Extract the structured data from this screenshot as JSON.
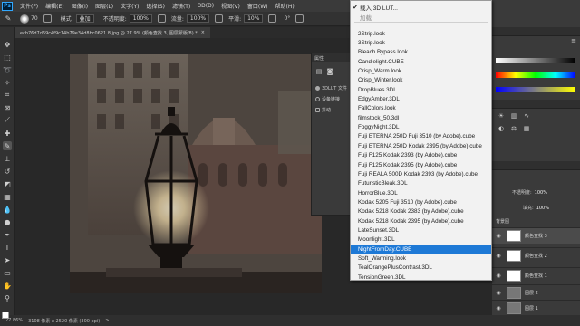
{
  "menubar": {
    "logo": "Ps",
    "items": [
      "文件(F)",
      "编辑(E)",
      "图像(I)",
      "图层(L)",
      "文字(Y)",
      "选择(S)",
      "滤镜(T)",
      "3D(D)",
      "视图(V)",
      "窗口(W)",
      "帮助(H)"
    ],
    "window_controls": [
      "—",
      "□",
      "✕"
    ]
  },
  "options_bar": {
    "brush_size": "70",
    "mode_label": "模式:",
    "mode_value": "叠加",
    "opacity_label": "不透明度:",
    "opacity_value": "100%",
    "flow_label": "流量:",
    "flow_value": "100%",
    "smoothing_label": "平滑:",
    "smoothing_value": "10%",
    "angle_value": "0°"
  },
  "document": {
    "tab_title": "ecb76d7d69c4f9c14b79e34d8bc0621 8.jpg @ 27.9% (颜色查找 3, 图层蒙版/8) *",
    "close_glyph": "×"
  },
  "status_bar": {
    "zoom": "27.86%",
    "doc_size": "3108 像素 x 2520 像素 (300 ppi)",
    "arrow": ">"
  },
  "properties_panel": {
    "title": "属性",
    "option_1": "3DLUT 文件",
    "option_2": "设备链接",
    "option_3": "抖动"
  },
  "lut_menu": {
    "load_label": "载入 3D LUT...",
    "load_checked": "✔",
    "section_label": "加载",
    "items": [
      "2Strip.look",
      "3Strip.look",
      "Bleach Bypass.look",
      "Candlelight.CUBE",
      "Crisp_Warm.look",
      "Crisp_Winter.look",
      "DropBlues.3DL",
      "EdgyAmber.3DL",
      "FallColors.look",
      "filmstock_50.3dl",
      "FoggyNight.3DL",
      "Fuji ETERNA 250D Fuji 3510 (by Adobe).cube",
      "Fuji ETERNA 250D Kodak 2395 (by Adobe).cube",
      "Fuji F125 Kodak 2393 (by Adobe).cube",
      "Fuji F125 Kodak 2395 (by Adobe).cube",
      "Fuji REALA 500D Kodak 2393 (by Adobe).cube",
      "FuturisticBleak.3DL",
      "HorrorBlue.3DL",
      "Kodak 5205 Fuji 3510 (by Adobe).cube",
      "Kodak 5218 Kodak 2383 (by Adobe).cube",
      "Kodak 5218 Kodak 2395 (by Adobe).cube",
      "LateSunset.3DL",
      "Moonlight.3DL",
      "NightFromDay.CUBE",
      "Soft_Warming.look",
      "TealOrangePlusContrast.3DL",
      "TensionGreen.3DL"
    ],
    "highlighted_index": 23
  },
  "right_panels": {
    "opacity_label": "不透明度:",
    "opacity_value": "100%",
    "fill_label": "填充:",
    "fill_value": "100%",
    "group_label": "背景图",
    "layers": [
      {
        "name": "颜色查找 3",
        "thumb": "white",
        "selected": true
      },
      {
        "name": "颜色查找 2",
        "thumb": "white",
        "selected": false
      },
      {
        "name": "颜色查找 1",
        "thumb": "white",
        "selected": false
      },
      {
        "name": "图层 2",
        "thumb": "dark",
        "selected": false
      },
      {
        "name": "图层 1",
        "thumb": "dark",
        "selected": false
      }
    ],
    "eye_glyph": "◉"
  },
  "colors": {
    "accent_highlight": "#1e79d6",
    "photoshop_blue": "#31a8ff"
  }
}
